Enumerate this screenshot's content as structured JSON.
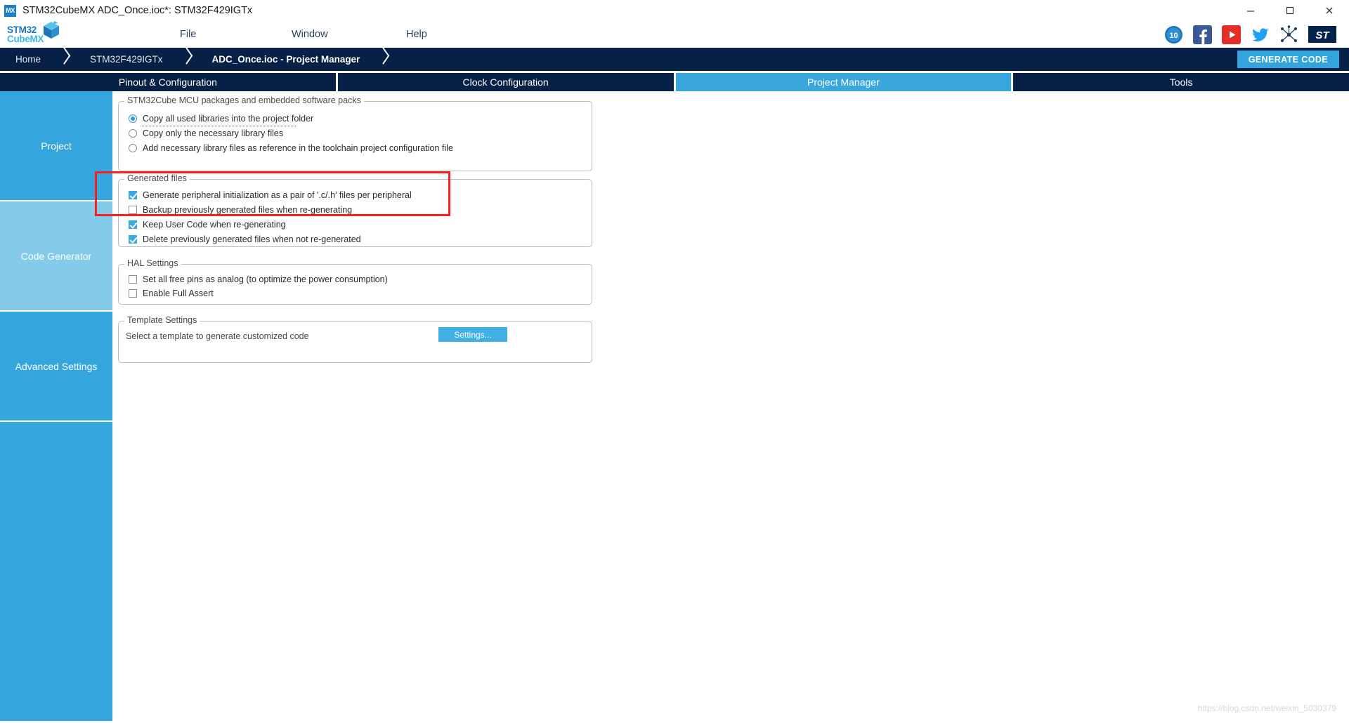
{
  "window": {
    "app_icon_label": "MX",
    "title": "STM32CubeMX ADC_Once.ioc*: STM32F429IGTx",
    "minimize_label": "Minimize",
    "maximize_label": "Maximize",
    "close_label": "Close"
  },
  "brand": {
    "line1": "STM32",
    "line2": "CubeMX"
  },
  "menu": {
    "file": "File",
    "window": "Window",
    "help": "Help"
  },
  "social": {
    "anniversary": "10",
    "facebook_name": "facebook-icon",
    "youtube_name": "youtube-icon",
    "twitter_name": "twitter-icon",
    "network_name": "network-icon",
    "st_logo_name": "st-logo-icon"
  },
  "breadcrumb": {
    "items": [
      {
        "label": "Home",
        "active": false
      },
      {
        "label": "STM32F429IGTx",
        "active": false
      },
      {
        "label": "ADC_Once.ioc - Project Manager",
        "active": true
      }
    ],
    "generate_code": "GENERATE CODE"
  },
  "tabs": [
    {
      "label": "Pinout & Configuration",
      "active": false
    },
    {
      "label": "Clock Configuration",
      "active": false
    },
    {
      "label": "Project Manager",
      "active": true
    },
    {
      "label": "Tools",
      "active": false
    }
  ],
  "sidebar": {
    "items": [
      {
        "label": "Project",
        "active": false
      },
      {
        "label": "Code Generator",
        "active": true
      },
      {
        "label": "Advanced Settings",
        "active": false
      }
    ]
  },
  "groups": {
    "packages": {
      "legend": "STM32Cube MCU packages and embedded software packs",
      "options": [
        {
          "label": "Copy all used libraries into the project folder",
          "selected": true,
          "focused": true
        },
        {
          "label": "Copy only the necessary library files",
          "selected": false,
          "focused": false
        },
        {
          "label": "Add necessary library files as reference in the toolchain project configuration file",
          "selected": false,
          "focused": false
        }
      ]
    },
    "generated_files": {
      "legend": "Generated files",
      "options": [
        {
          "label": "Generate peripheral initialization as a pair of '.c/.h' files per peripheral",
          "checked": true
        },
        {
          "label": "Backup previously generated files when re-generating",
          "checked": false
        },
        {
          "label": "Keep User Code when re-generating",
          "checked": true
        },
        {
          "label": "Delete previously generated files when not re-generated",
          "checked": true
        }
      ]
    },
    "hal_settings": {
      "legend": "HAL Settings",
      "options": [
        {
          "label": "Set all free pins as analog (to optimize the power consumption)",
          "checked": false
        },
        {
          "label": "Enable Full Assert",
          "checked": false
        }
      ]
    },
    "template_settings": {
      "legend": "Template Settings",
      "description": "Select a template to generate customized code",
      "settings_button": "Settings..."
    }
  },
  "annotation": {
    "highlight_color": "#fb1f1f",
    "highlight_name": "red-highlight-rectangle"
  },
  "watermark": {
    "text": "https://blog.csdn.net/weixin_5030379"
  },
  "colors": {
    "navy": "#072146",
    "accent_blue": "#3aa6de",
    "light_blue": "#84cbe9",
    "generate_code_bg": "#31a3dd"
  }
}
